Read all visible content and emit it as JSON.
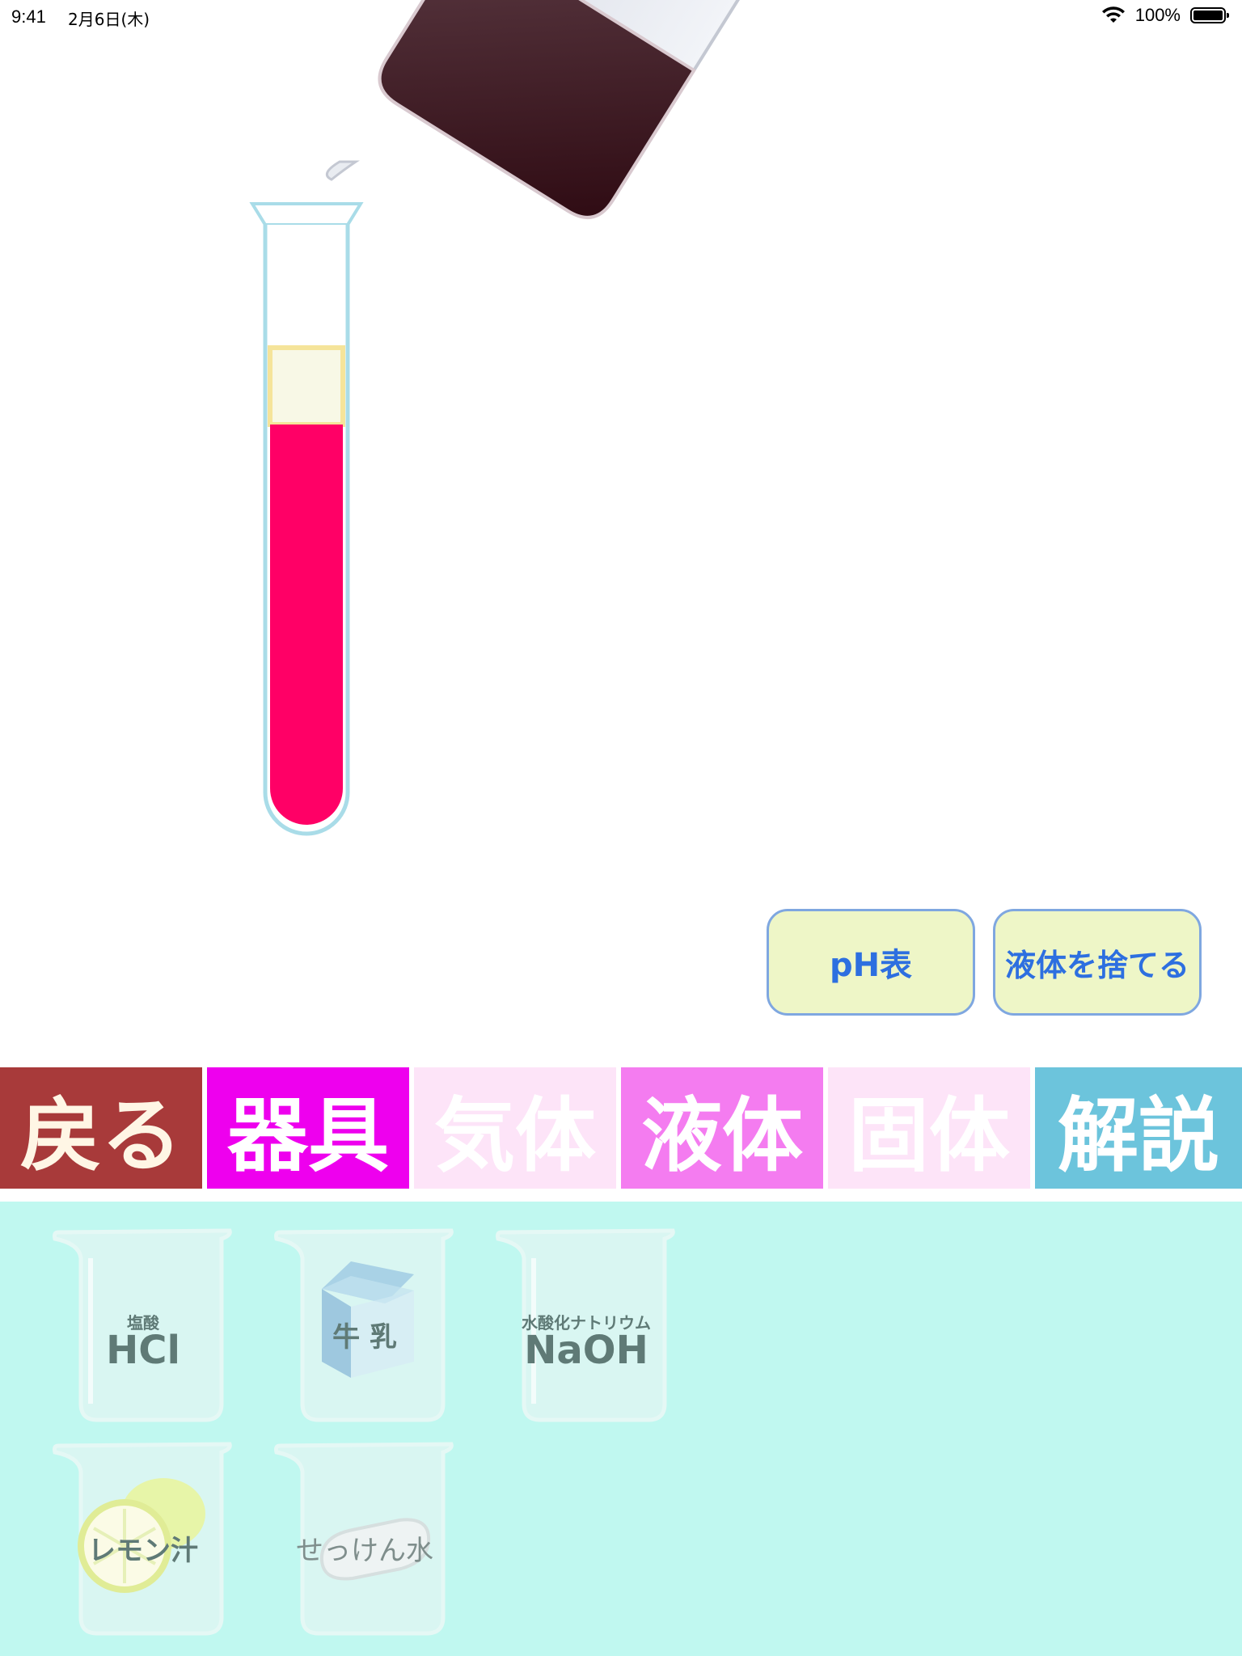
{
  "status_bar": {
    "time": "9:41",
    "date": "2月6日(木)",
    "battery": "100%",
    "wifi_icon": "wifi-icon",
    "battery_icon": "battery-icon"
  },
  "experiment": {
    "test_tube_liquid_color": "#ff0066",
    "foam_color": "#f8f8e6",
    "beaker_liquid_color": "#3a1a24"
  },
  "actions": {
    "ph_table": "pH表",
    "discard_liquid": "液体を捨てる"
  },
  "tabs": [
    {
      "label": "戻る",
      "color": "#a83a3a"
    },
    {
      "label": "器具",
      "color": "#ee00ee"
    },
    {
      "label": "気体",
      "color": "#fde4f8"
    },
    {
      "label": "液体",
      "color": "#f47cf0"
    },
    {
      "label": "固体",
      "color": "#fde4f8"
    },
    {
      "label": "解説",
      "color": "#6cc4dc"
    }
  ],
  "liquids": [
    {
      "small": "塩酸",
      "big": "HCl"
    },
    {
      "label": "牛 乳"
    },
    {
      "small": "水酸化ナトリウム",
      "big": "NaOH"
    },
    {
      "label": "レモン汁"
    },
    {
      "label": "せっけん水"
    }
  ],
  "colors": {
    "tray_background": "#c0f8f0",
    "button_background": "#eef6c7",
    "button_text": "#2d6fe0"
  }
}
